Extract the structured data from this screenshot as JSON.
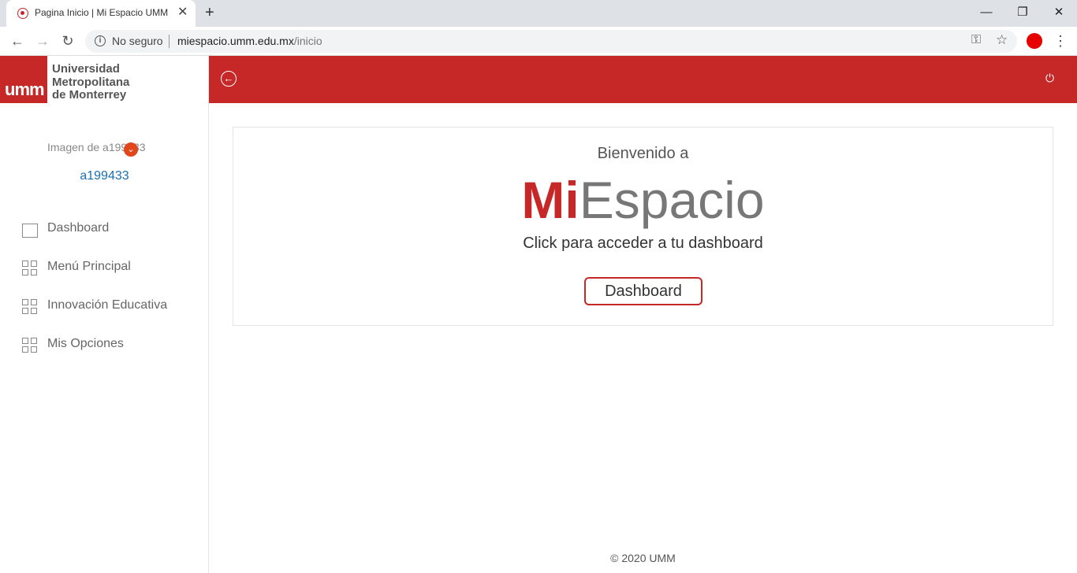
{
  "browser": {
    "tab_title": "Pagina Inicio | Mi Espacio UMM",
    "tab_close": "✕",
    "new_tab": "+",
    "security_label": "No seguro",
    "url_host": "miespacio.umm.edu.mx",
    "url_path": "/inicio",
    "window_controls": {
      "minimize": "—",
      "restore": "❐",
      "close": "✕"
    }
  },
  "sidebar": {
    "logo_mark": "umm",
    "logo_lines": [
      "Universidad",
      "Metropolitana",
      "de Monterrey"
    ],
    "avatar_alt": "Imagen de a199433",
    "avatar_badge": "⌄",
    "username": "a199433",
    "items": [
      {
        "label": "Dashboard",
        "icon": "monitor-icon"
      },
      {
        "label": "Menú Principal",
        "icon": "grid-icon"
      },
      {
        "label": "Innovación Educativa",
        "icon": "grid-icon"
      },
      {
        "label": "Mis Opciones",
        "icon": "grid-icon"
      }
    ]
  },
  "topbar": {
    "back_icon": "←",
    "power_icon": "⏻"
  },
  "main": {
    "welcome": "Bienvenido a",
    "brand_mi": "Mi",
    "brand_rest": "Espacio",
    "hint": "Click para acceder a tu dashboard",
    "button_label": "Dashboard"
  },
  "footer": {
    "text": "© 2020 UMM"
  },
  "colors": {
    "brand_red": "#c62828",
    "link_blue": "#1a6fb0",
    "badge_orange": "#e2461d"
  }
}
